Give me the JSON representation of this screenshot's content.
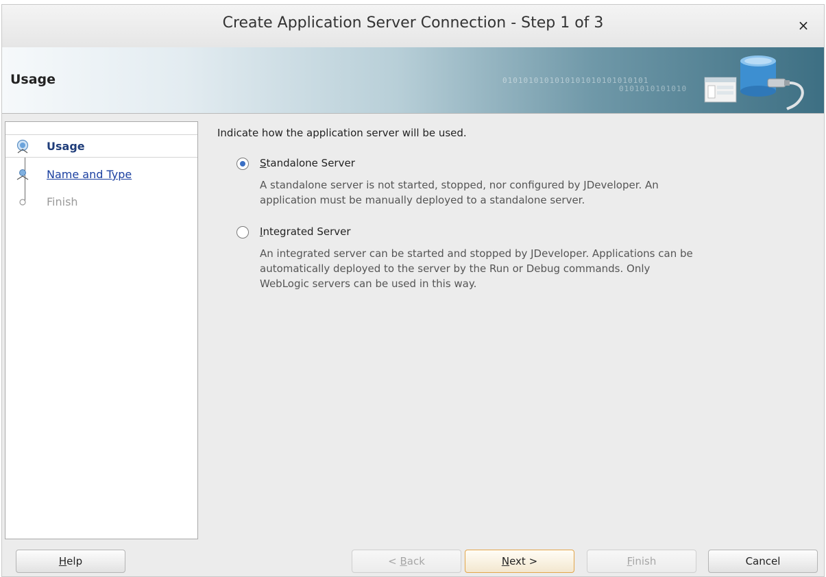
{
  "window": {
    "title": "Create Application Server Connection - Step 1 of 3",
    "close_glyph": "×"
  },
  "banner": {
    "title": "Usage",
    "binary_text_1": "0101010101010101010101010101",
    "binary_text_2": "0101010101010",
    "graphic_icon": "database-connection-icon"
  },
  "nav": {
    "items": [
      {
        "label": "Usage",
        "state": "current",
        "icon": "step-current-icon"
      },
      {
        "label": "Name and Type",
        "state": "link",
        "icon": "step-icon"
      },
      {
        "label": "Finish",
        "state": "disabled",
        "icon": "step-pending-icon"
      }
    ]
  },
  "content": {
    "prompt": "Indicate how  the application server will be used.",
    "options": [
      {
        "label_mnemonic": "S",
        "label_rest": "tandalone Server",
        "checked": true,
        "desc_lines": [
          "A standalone server is not started, stopped, nor configured by JDeveloper. An",
          "application must be manually deployed to a standalone server."
        ]
      },
      {
        "label_mnemonic": "I",
        "label_rest": "ntegrated Server",
        "checked": false,
        "desc_lines": [
          "An integrated server can be started and stopped by JDeveloper. Applications can be",
          "automatically deployed to the server by the Run or Debug commands. Only",
          "WebLogic servers can be used in this way."
        ]
      }
    ]
  },
  "footer": {
    "help": {
      "mnemonic": "H",
      "rest": "elp"
    },
    "back": {
      "prefix": "< ",
      "mnemonic": "B",
      "rest": "ack"
    },
    "next": {
      "mnemonic": "N",
      "rest": "ext >"
    },
    "finish": {
      "mnemonic": "F",
      "rest": "inish"
    },
    "cancel": {
      "label": "Cancel"
    }
  },
  "colors": {
    "accent_radio": "#3a6fc4",
    "link": "#1a3fa0",
    "default_button_border": "#e2a54a"
  }
}
